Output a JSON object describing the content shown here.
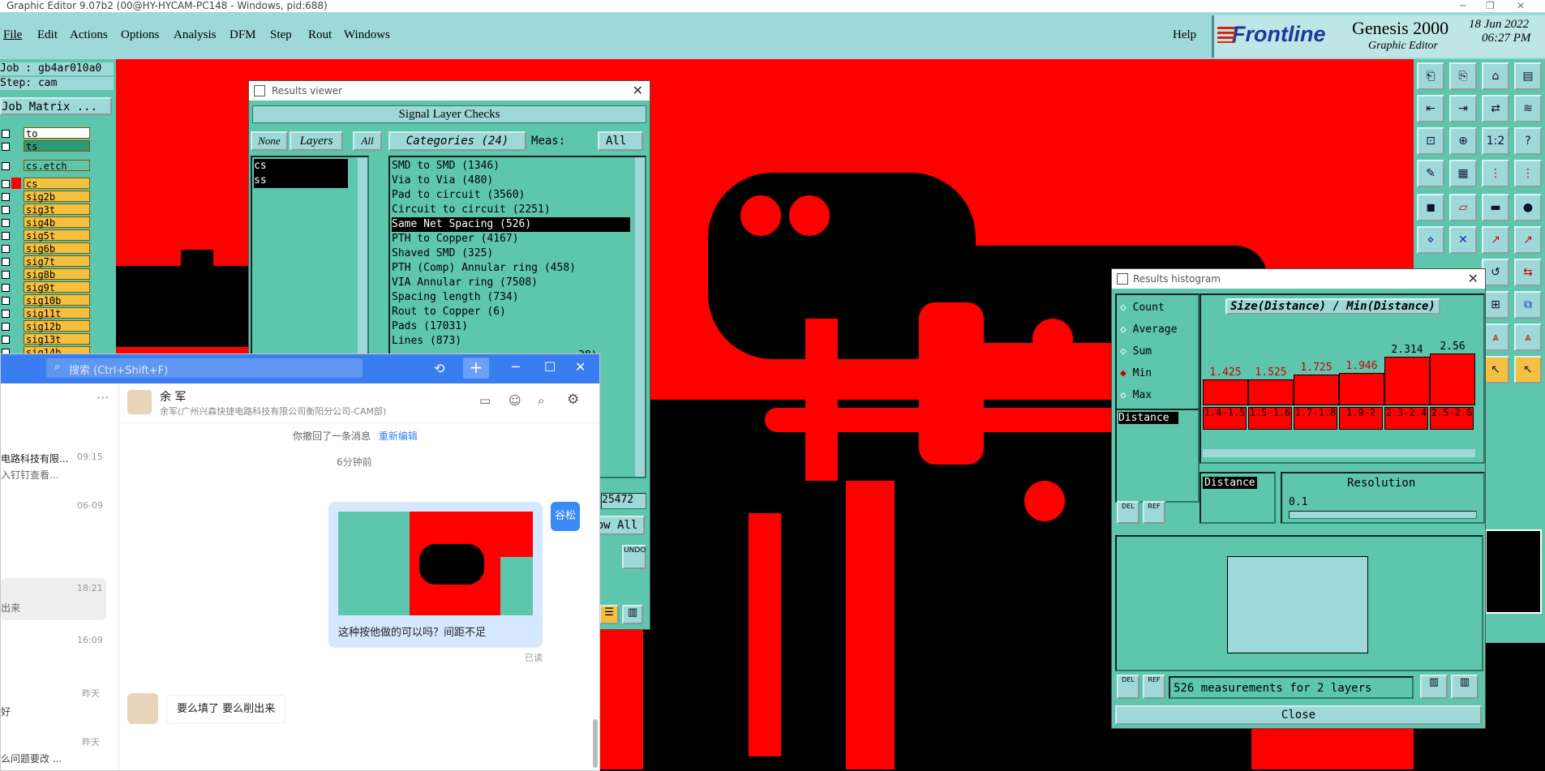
{
  "window": {
    "title": "Graphic Editor 9.07b2 (00@HY-HYCAM-PC148 - Windows, pid:688)",
    "controls": [
      "─",
      "❐",
      "✕"
    ]
  },
  "menubar": {
    "items": [
      "File",
      "Edit",
      "Actions",
      "Options",
      "Analysis",
      "DFM",
      "Step",
      "Rout",
      "Windows"
    ],
    "help": "Help"
  },
  "brand": {
    "logo": "Frontline",
    "product": "Genesis 2000",
    "subtitle": "Graphic Editor",
    "date": "18 Jun 2022",
    "time": "06:27 PM"
  },
  "left_panel": {
    "job": "Job : gb4ar010a0",
    "step": "Step: cam",
    "job_matrix": "Job Matrix ...",
    "layers": [
      {
        "name": "to",
        "color": "#ffffff"
      },
      {
        "name": "ts",
        "color": "#2a9a7a"
      },
      {
        "name": "cs.etch",
        "color": "#5fc6ae"
      },
      {
        "name": "cs",
        "color": "#f5c040"
      },
      {
        "name": "sig2b",
        "color": "#f5c040"
      },
      {
        "name": "sig3t",
        "color": "#f5c040"
      },
      {
        "name": "sig4b",
        "color": "#f5c040"
      },
      {
        "name": "sig5t",
        "color": "#f5c040"
      },
      {
        "name": "sig6b",
        "color": "#f5c040"
      },
      {
        "name": "sig7t",
        "color": "#f5c040"
      },
      {
        "name": "sig8b",
        "color": "#f5c040"
      },
      {
        "name": "sig9t",
        "color": "#f5c040"
      },
      {
        "name": "sig10b",
        "color": "#f5c040"
      },
      {
        "name": "sig11t",
        "color": "#f5c040"
      },
      {
        "name": "sig12b",
        "color": "#f5c040"
      },
      {
        "name": "sig13t",
        "color": "#f5c040"
      },
      {
        "name": "sig14b",
        "color": "#f5c040"
      }
    ]
  },
  "results_viewer": {
    "title": "Results viewer",
    "header": "Signal Layer Checks",
    "none_btn": "None",
    "layers_label": "Layers",
    "all_btn": "All",
    "categories_label": "Categories (24)",
    "meas_label": "Meas:",
    "meas_value": "All",
    "layers": [
      "cs",
      "ss"
    ],
    "categories": [
      "SMD to SMD (1346)",
      "Via to Via (480)",
      "Pad to circuit (3560)",
      "Circuit to circuit (2251)",
      "Same Net Spacing (526)",
      "PTH to Copper (4167)",
      "Shaved SMD (325)",
      "PTH (Comp) Annular ring (458)",
      "VIA Annular ring (7508)",
      "Spacing length (734)",
      "Rout to Copper (6)",
      "Pads (17031)",
      "Lines (873)"
    ],
    "selected_category": 4,
    "partial_count": "25472",
    "show_all": "ow All",
    "partial_row": "38)"
  },
  "histogram": {
    "title": "Results histogram",
    "modes": [
      "Count",
      "Average",
      "Sum",
      "Min",
      "Max"
    ],
    "selected_mode": "Min",
    "chart_title": "Size(Distance) / Min(Distance)",
    "measure_item": "Distance",
    "bars": [
      {
        "label": "1.4-1.5",
        "value": "1.425",
        "height": 0.3
      },
      {
        "label": "1.5-1.6",
        "value": "1.525",
        "height": 0.3
      },
      {
        "label": "1.7-1.8",
        "value": "1.725",
        "height": 0.36
      },
      {
        "label": "1.9-2",
        "value": "1.946",
        "height": 0.38
      },
      {
        "label": "2.3-2.4",
        "value": "2.314",
        "height": 0.58
      },
      {
        "label": "2.5-2.6",
        "value": "2.56",
        "height": 0.62
      }
    ],
    "distance_label": "Distance",
    "resolution_label": "Resolution",
    "resolution_value": "0.1",
    "measurements": "526 measurements for 2 layers",
    "close": "Close",
    "del": "DEL",
    "ref": "REF"
  },
  "chat": {
    "search_placeholder": "搜索 (Ctrl+Shift+F)",
    "contact_name": "余 军",
    "contact_org": "余军(广州兴森快捷电路科技有限公司衡阳分公司-CAM部)",
    "recall_notice": "你撤回了一条消息",
    "re_edit": "重新编辑",
    "time_divider": "6分钟前",
    "sender_name": "谷松",
    "message_text": "这种按他做的可以吗？间距不足",
    "read_status": "已读",
    "reply_text": "要么填了 要么削出来",
    "sidebar": [
      {
        "preview": "电路科技有限...",
        "sub": "入钉钉查看...",
        "time": "09:15"
      },
      {
        "preview": "",
        "sub": "",
        "time": "06-09"
      },
      {
        "preview": "",
        "sub": "出来",
        "time": "18:21"
      },
      {
        "preview": "",
        "sub": "",
        "time": "16:09"
      },
      {
        "preview": "好",
        "sub": "",
        "time": "昨天"
      },
      {
        "preview": "么问题要改 ...",
        "sub": "",
        "time": "昨天"
      },
      {
        "preview": "",
        "sub": "",
        "time": "昨天"
      }
    ]
  }
}
